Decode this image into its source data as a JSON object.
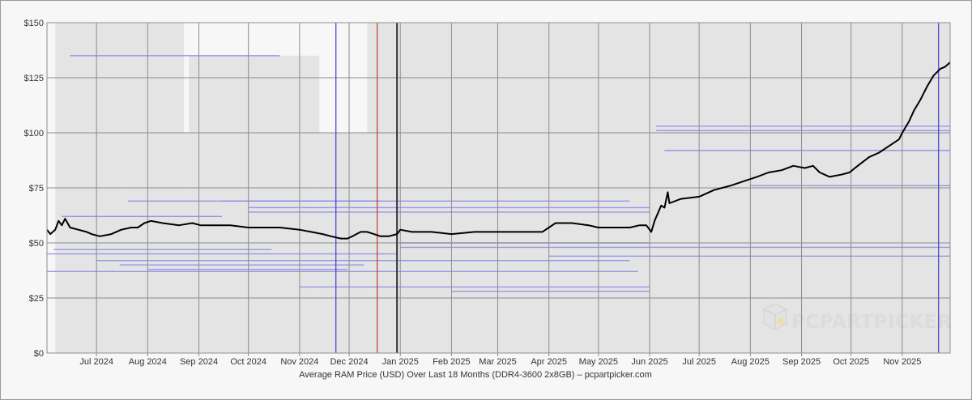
{
  "chart_data": {
    "type": "line",
    "xlabel": "Average RAM Price (USD) Over Last 18 Months (DDR4-3600 2x8GB) – pcpartpicker.com",
    "ylabel": "",
    "y_ticks": [
      "$0",
      "$25",
      "$50",
      "$75",
      "$100",
      "$125",
      "$150"
    ],
    "ylim": [
      0,
      150
    ],
    "x_range": [
      "2024-06-01",
      "2025-11-30"
    ],
    "x_ticks": [
      {
        "date": "2024-07-01",
        "label": "Jul 2024"
      },
      {
        "date": "2024-08-01",
        "label": "Aug 2024"
      },
      {
        "date": "2024-09-01",
        "label": "Sep 2024"
      },
      {
        "date": "2024-10-01",
        "label": "Oct 2024"
      },
      {
        "date": "2024-11-01",
        "label": "Nov 2024"
      },
      {
        "date": "2024-12-01",
        "label": "Dec 2024"
      },
      {
        "date": "2025-01-01",
        "label": "Jan 2025"
      },
      {
        "date": "2025-02-01",
        "label": "Feb 2025"
      },
      {
        "date": "2025-03-01",
        "label": "Mar 2025"
      },
      {
        "date": "2025-04-01",
        "label": "Apr 2025"
      },
      {
        "date": "2025-05-01",
        "label": "May 2025"
      },
      {
        "date": "2025-06-01",
        "label": "Jun 2025"
      },
      {
        "date": "2025-07-01",
        "label": "Jul 2025"
      },
      {
        "date": "2025-08-01",
        "label": "Aug 2025"
      },
      {
        "date": "2025-09-01",
        "label": "Sep 2025"
      },
      {
        "date": "2025-10-01",
        "label": "Oct 2025"
      },
      {
        "date": "2025-11-01",
        "label": "Nov 2025"
      }
    ],
    "grid": true,
    "average_line": {
      "color": "#000000",
      "points": [
        [
          "2024-06-01",
          56
        ],
        [
          "2024-06-03",
          54
        ],
        [
          "2024-06-06",
          56
        ],
        [
          "2024-06-08",
          60
        ],
        [
          "2024-06-10",
          58
        ],
        [
          "2024-06-12",
          61
        ],
        [
          "2024-06-15",
          57
        ],
        [
          "2024-06-20",
          56
        ],
        [
          "2024-06-25",
          55
        ],
        [
          "2024-06-28",
          54
        ],
        [
          "2024-07-03",
          53
        ],
        [
          "2024-07-10",
          54
        ],
        [
          "2024-07-16",
          56
        ],
        [
          "2024-07-22",
          57
        ],
        [
          "2024-07-26",
          57
        ],
        [
          "2024-07-30",
          59
        ],
        [
          "2024-08-03",
          60
        ],
        [
          "2024-08-10",
          59
        ],
        [
          "2024-08-20",
          58
        ],
        [
          "2024-08-28",
          59
        ],
        [
          "2024-09-02",
          58
        ],
        [
          "2024-09-10",
          58
        ],
        [
          "2024-09-20",
          58
        ],
        [
          "2024-10-01",
          57
        ],
        [
          "2024-10-10",
          57
        ],
        [
          "2024-10-20",
          57
        ],
        [
          "2024-11-01",
          56
        ],
        [
          "2024-11-08",
          55
        ],
        [
          "2024-11-15",
          54
        ],
        [
          "2024-11-20",
          53
        ],
        [
          "2024-11-26",
          52
        ],
        [
          "2024-11-30",
          52
        ],
        [
          "2024-12-03",
          53
        ],
        [
          "2024-12-08",
          55
        ],
        [
          "2024-12-12",
          55
        ],
        [
          "2024-12-16",
          54
        ],
        [
          "2024-12-20",
          53
        ],
        [
          "2024-12-25",
          53
        ],
        [
          "2024-12-30",
          54
        ],
        [
          "2025-01-01",
          56
        ],
        [
          "2025-01-08",
          55
        ],
        [
          "2025-01-20",
          55
        ],
        [
          "2025-02-01",
          54
        ],
        [
          "2025-02-15",
          55
        ],
        [
          "2025-03-01",
          55
        ],
        [
          "2025-03-15",
          55
        ],
        [
          "2025-03-28",
          55
        ],
        [
          "2025-04-01",
          57
        ],
        [
          "2025-04-05",
          59
        ],
        [
          "2025-04-15",
          59
        ],
        [
          "2025-04-25",
          58
        ],
        [
          "2025-05-01",
          57
        ],
        [
          "2025-05-10",
          57
        ],
        [
          "2025-05-20",
          57
        ],
        [
          "2025-05-26",
          58
        ],
        [
          "2025-05-30",
          58
        ],
        [
          "2025-06-02",
          55
        ],
        [
          "2025-06-04",
          60
        ],
        [
          "2025-06-08",
          67
        ],
        [
          "2025-06-10",
          66
        ],
        [
          "2025-06-12",
          73
        ],
        [
          "2025-06-13",
          68
        ],
        [
          "2025-06-20",
          70
        ],
        [
          "2025-07-01",
          71
        ],
        [
          "2025-07-10",
          74
        ],
        [
          "2025-07-20",
          76
        ],
        [
          "2025-07-28",
          78
        ],
        [
          "2025-08-05",
          80
        ],
        [
          "2025-08-12",
          82
        ],
        [
          "2025-08-20",
          83
        ],
        [
          "2025-08-27",
          85
        ],
        [
          "2025-09-03",
          84
        ],
        [
          "2025-09-08",
          85
        ],
        [
          "2025-09-12",
          82
        ],
        [
          "2025-09-18",
          80
        ],
        [
          "2025-09-25",
          81
        ],
        [
          "2025-09-30",
          82
        ],
        [
          "2025-10-05",
          85
        ],
        [
          "2025-10-12",
          89
        ],
        [
          "2025-10-18",
          91
        ],
        [
          "2025-10-24",
          94
        ],
        [
          "2025-10-30",
          97
        ],
        [
          "2025-11-01",
          100
        ],
        [
          "2025-11-05",
          105
        ],
        [
          "2025-11-08",
          110
        ],
        [
          "2025-11-12",
          115
        ],
        [
          "2025-11-16",
          121
        ],
        [
          "2025-11-20",
          126
        ],
        [
          "2025-11-24",
          129
        ],
        [
          "2025-11-27",
          130
        ],
        [
          "2025-11-30",
          132
        ]
      ]
    },
    "markers": [
      {
        "date": "2024-11-23",
        "color": "#3a3ad6"
      },
      {
        "date": "2024-12-18",
        "color": "#c0392b"
      },
      {
        "date": "2024-12-30",
        "color": "#333333"
      },
      {
        "date": "2025-11-23",
        "color": "#3a3ad6"
      }
    ],
    "range_bands": {
      "colors": {
        "band": "#e4e4e4",
        "shade": "#d6d6d6",
        "listing": "#8888e6"
      },
      "columns": [
        {
          "from": "2024-06-06",
          "to": "2024-07-20",
          "low": 0,
          "high": 150
        },
        {
          "from": "2024-07-20",
          "to": "2024-08-05",
          "low": 0,
          "high": 150
        },
        {
          "from": "2024-08-05",
          "to": "2024-08-23",
          "low": 0,
          "high": 150
        },
        {
          "from": "2024-08-23",
          "to": "2024-08-26",
          "low": 0,
          "high": 100
        },
        {
          "from": "2024-08-26",
          "to": "2024-10-01",
          "low": 0,
          "high": 135
        },
        {
          "from": "2024-10-01",
          "to": "2024-11-13",
          "low": 0,
          "high": 135
        },
        {
          "from": "2024-11-13",
          "to": "2024-12-12",
          "low": 0,
          "high": 100
        },
        {
          "from": "2024-12-12",
          "to": "2024-12-16",
          "low": 0,
          "high": 150
        },
        {
          "from": "2024-12-16",
          "to": "2025-11-30",
          "low": 0,
          "high": 150
        }
      ],
      "listing_segments": [
        {
          "from": "2024-06-01",
          "to": "2024-12-30",
          "value": 45
        },
        {
          "from": "2024-07-01",
          "to": "2025-05-20",
          "value": 42
        },
        {
          "from": "2024-07-15",
          "to": "2024-12-10",
          "value": 40
        },
        {
          "from": "2024-06-05",
          "to": "2024-10-15",
          "value": 47
        },
        {
          "from": "2024-08-01",
          "to": "2024-11-30",
          "value": 38
        },
        {
          "from": "2024-09-15",
          "to": "2025-05-20",
          "value": 69
        },
        {
          "from": "2024-07-20",
          "to": "2024-12-20",
          "value": 69
        },
        {
          "from": "2024-10-01",
          "to": "2025-06-01",
          "value": 66
        },
        {
          "from": "2024-10-01",
          "to": "2025-06-01",
          "value": 64
        },
        {
          "from": "2024-06-10",
          "to": "2024-09-15",
          "value": 62
        },
        {
          "from": "2025-06-05",
          "to": "2025-11-30",
          "value": 103
        },
        {
          "from": "2025-06-05",
          "to": "2025-11-30",
          "value": 101
        },
        {
          "from": "2025-06-10",
          "to": "2025-11-30",
          "value": 92
        },
        {
          "from": "2025-08-01",
          "to": "2025-11-30",
          "value": 76
        },
        {
          "from": "2025-01-01",
          "to": "2025-06-01",
          "value": 50
        },
        {
          "from": "2024-06-01",
          "to": "2025-05-25",
          "value": 37
        },
        {
          "from": "2024-11-01",
          "to": "2025-06-01",
          "value": 30
        },
        {
          "from": "2025-02-01",
          "to": "2025-06-01",
          "value": 28
        },
        {
          "from": "2025-01-01",
          "to": "2025-11-30",
          "value": 48
        },
        {
          "from": "2025-04-01",
          "to": "2025-11-30",
          "value": 44
        },
        {
          "from": "2024-06-15",
          "to": "2024-10-20",
          "value": 135
        }
      ]
    },
    "watermark": "PCPARTPICKER"
  }
}
